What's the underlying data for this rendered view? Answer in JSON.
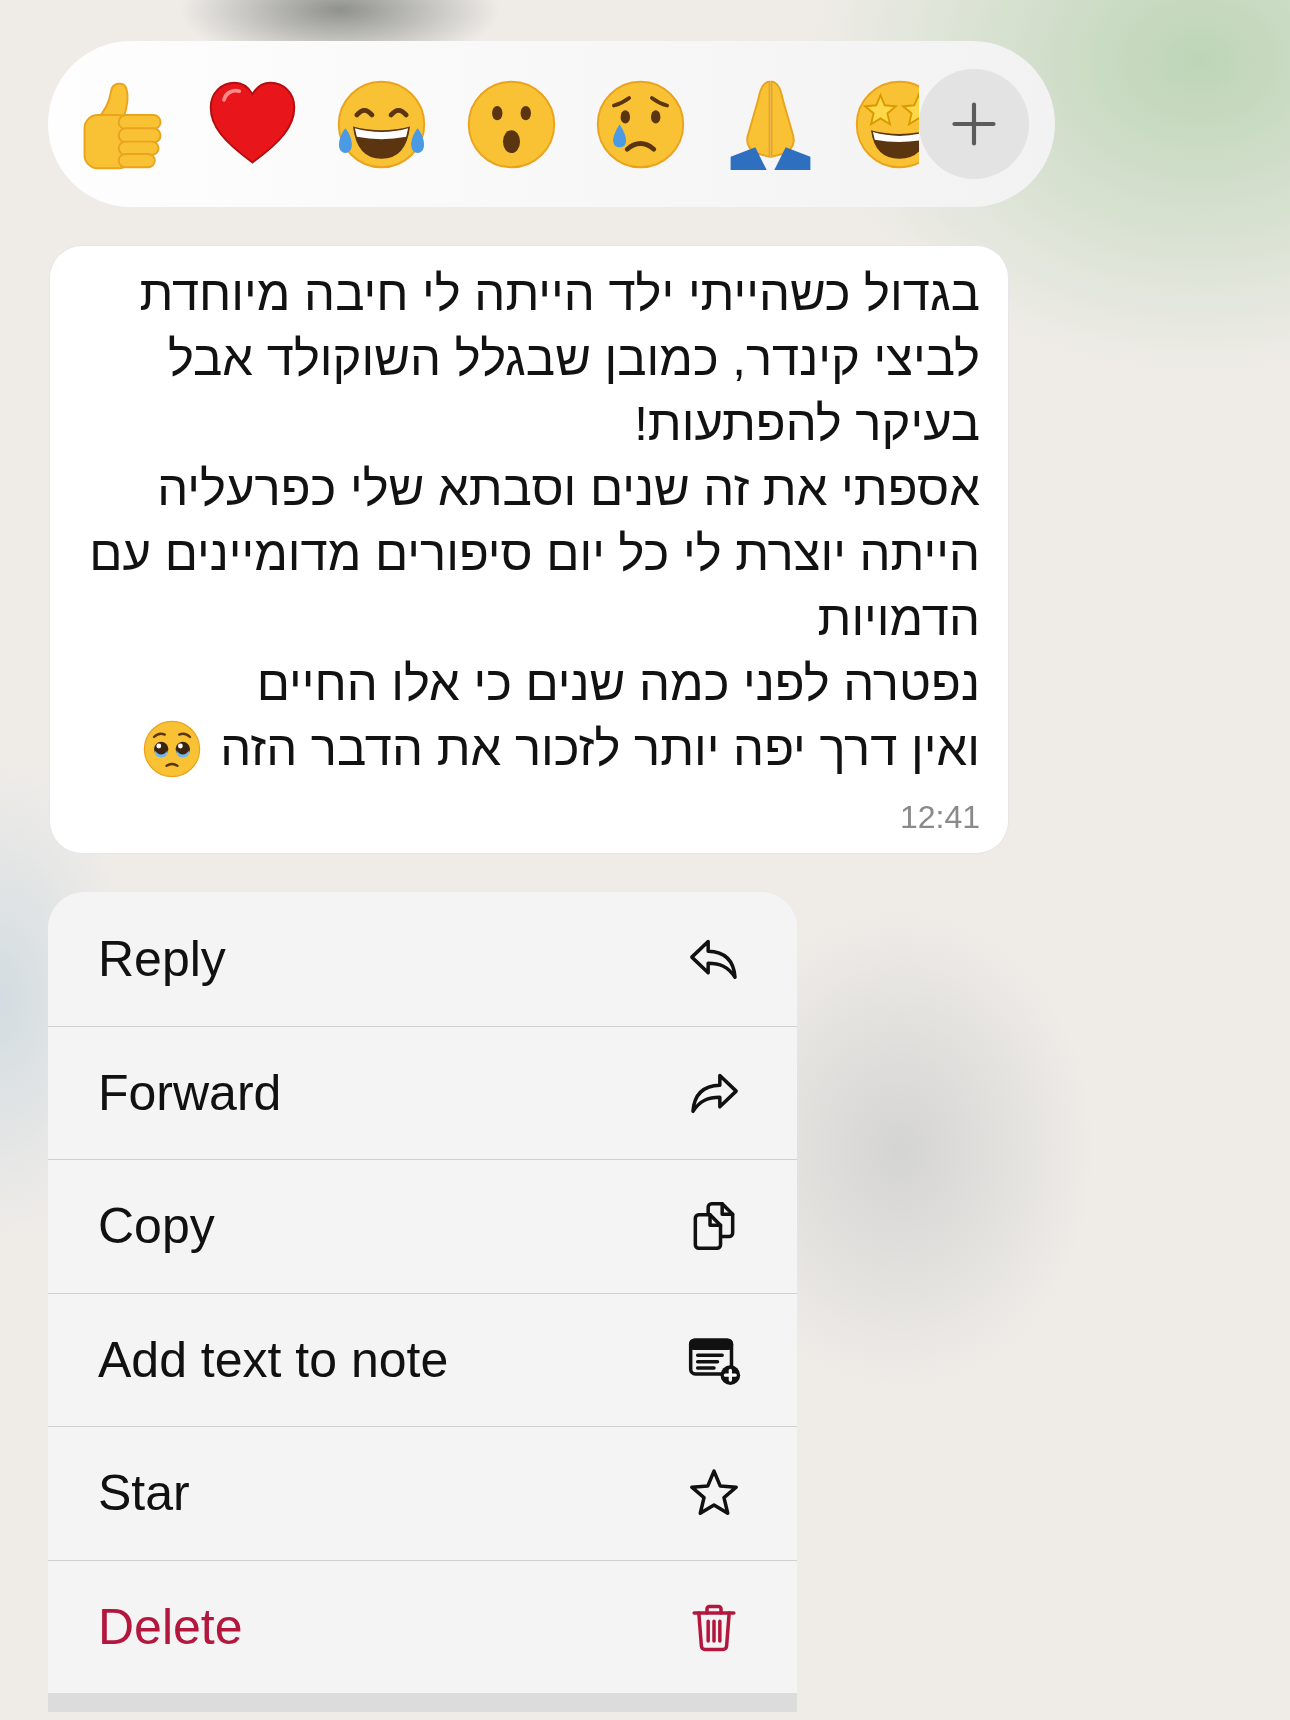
{
  "reactions": [
    {
      "kind": "thumbs-up",
      "partly_hidden": false
    },
    {
      "kind": "heart",
      "partly_hidden": false
    },
    {
      "kind": "tears-of-joy",
      "partly_hidden": false
    },
    {
      "kind": "surprised",
      "partly_hidden": false
    },
    {
      "kind": "crying",
      "partly_hidden": false
    },
    {
      "kind": "folded-hands",
      "partly_hidden": false
    },
    {
      "kind": "star-struck",
      "partly_hidden": true
    }
  ],
  "message": {
    "paragraphs": [
      {
        "text": "בגדול כשהייתי ילד הייתה לי חיבה מיוחדת\nלביצי קינדר, כמובן שבגלל השוקולד אבל\nבעיקר להפתעות!"
      },
      {
        "text": "אספתי את זה שנים וסבתא שלי כפרעליה\nהייתה יוצרת לי כל יום סיפורים מדומיינים עם\nהדמויות"
      },
      {
        "text": "נפטרה לפני כמה שנים כי אלו החיים"
      },
      {
        "text": "ואין דרך יפה יותר לזכור את הדבר הזה",
        "trailing_emoji": {
          "kind": "holding-back-tears"
        }
      }
    ],
    "time": "12:41"
  },
  "menu": {
    "items": [
      {
        "label": "Reply",
        "kind": "reply",
        "destructive": false
      },
      {
        "label": "Forward",
        "kind": "forward",
        "destructive": false
      },
      {
        "label": "Copy",
        "kind": "copy",
        "destructive": false
      },
      {
        "label": "Add text to note",
        "kind": "add-note",
        "destructive": false
      },
      {
        "label": "Star",
        "kind": "star",
        "destructive": false
      },
      {
        "label": "Delete",
        "kind": "delete",
        "destructive": true
      }
    ]
  }
}
